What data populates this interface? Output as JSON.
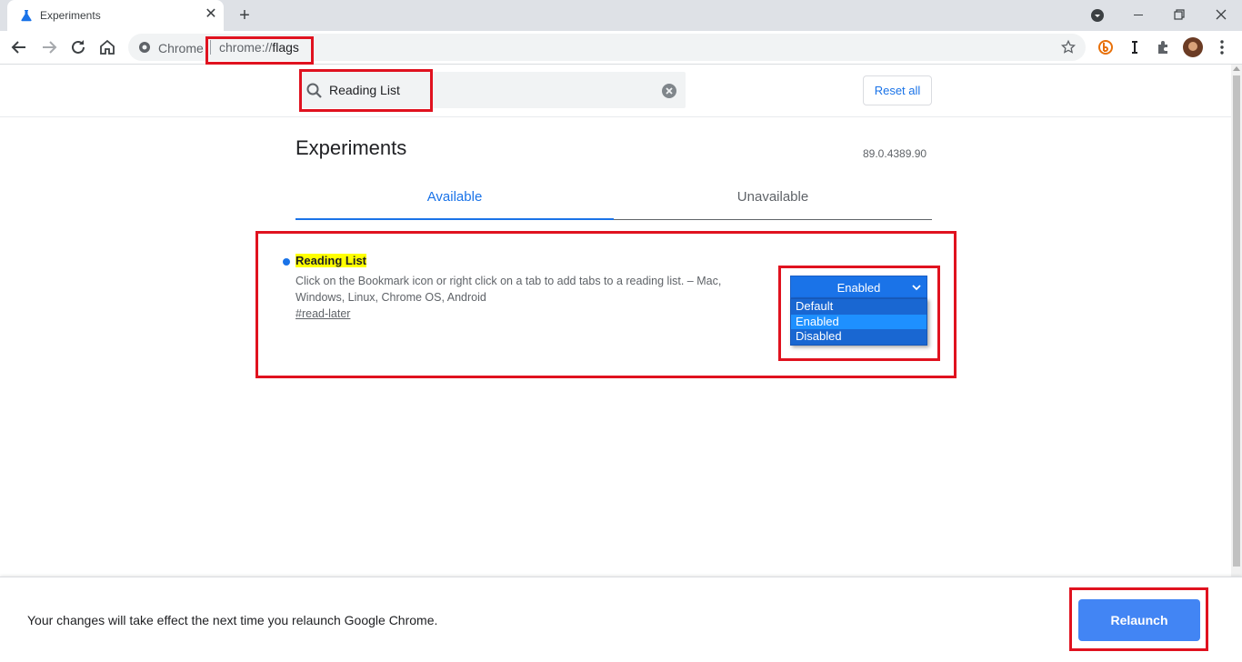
{
  "browser": {
    "tab_title": "Experiments",
    "tab_close": "✕",
    "new_tab": "+",
    "site_chip": "Chrome",
    "url_scheme": "chrome://",
    "url_host": "flags"
  },
  "search": {
    "value": "Reading List",
    "reset_label": "Reset all"
  },
  "main": {
    "title": "Experiments",
    "version": "89.0.4389.90",
    "tabs": [
      {
        "label": "Available",
        "active": true
      },
      {
        "label": "Unavailable",
        "active": false
      }
    ]
  },
  "experiment": {
    "name": "Reading List",
    "description": "Click on the Bookmark icon or right click on a tab to add tabs to a reading list. – Mac, Windows, Linux, Chrome OS, Android",
    "link": "#read-later",
    "selected": "Enabled",
    "options": [
      "Default",
      "Enabled",
      "Disabled"
    ]
  },
  "footer": {
    "message": "Your changes will take effect the next time you relaunch Google Chrome.",
    "relaunch_label": "Relaunch"
  },
  "colors": {
    "accent": "#1a73e8",
    "highlight": "#ffff00",
    "annotation": "#e0121f",
    "relaunch": "#4285f4"
  }
}
